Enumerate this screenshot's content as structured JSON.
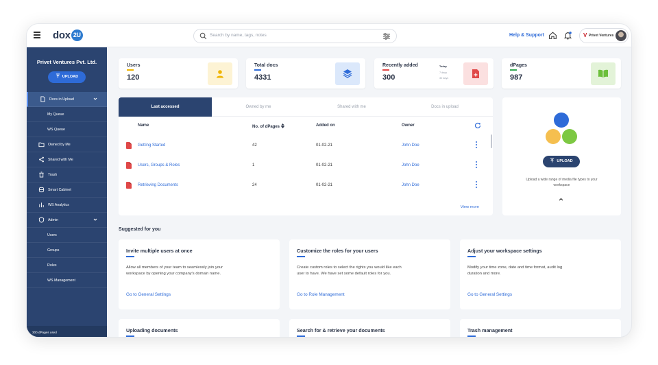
{
  "header": {
    "logo_text": "dox",
    "logo_badge": "2U",
    "search_placeholder": "Search by name, tags, notes",
    "help_label": "Help & Support",
    "org_short": "Privet Ventures",
    "org_logo_letter": "V"
  },
  "sidebar": {
    "org_name": "Privet Ventures Pvt. Ltd.",
    "upload_label": "UPLOAD",
    "items": [
      {
        "label": "Docs in Upload"
      },
      {
        "label": "My Queue"
      },
      {
        "label": "WS Queue"
      },
      {
        "label": "Owned by Me"
      },
      {
        "label": "Shared with Me"
      },
      {
        "label": "Trash"
      },
      {
        "label": "Smart Cabinet"
      },
      {
        "label": "WS Analytics"
      },
      {
        "label": "Admin"
      },
      {
        "label": "Users"
      },
      {
        "label": "Groups"
      },
      {
        "label": "Roles"
      },
      {
        "label": "WS Management"
      }
    ],
    "used_text": "300 dPages used"
  },
  "stats": [
    {
      "label": "Users",
      "value": "120",
      "accent": "#f0b400"
    },
    {
      "label": "Total docs",
      "value": "4331",
      "accent": "#2e6bd8"
    },
    {
      "label": "Recently added",
      "value": "300",
      "accent": "#e04848",
      "periods": [
        "Today",
        "7 days",
        "30 days"
      ]
    },
    {
      "label": "dPages",
      "value": "987",
      "accent": "#34a853"
    }
  ],
  "table": {
    "tabs": [
      "Last accessed",
      "Owned by me",
      "Shared with me",
      "Docs in upload"
    ],
    "columns": [
      "Name",
      "No. of dPages",
      "Added on",
      "Owner"
    ],
    "rows": [
      {
        "name": "Getting Started",
        "pages": "42",
        "added": "01-02-21",
        "owner": "John Doe"
      },
      {
        "name": "Users, Groups & Roles",
        "pages": "1",
        "added": "01-02-21",
        "owner": "John Doe"
      },
      {
        "name": "Retrieving Documents",
        "pages": "24",
        "added": "01-02-21",
        "owner": "John Doe"
      }
    ],
    "view_more": "View more"
  },
  "upload_panel": {
    "button": "UPLOAD",
    "text": "Upload a wide range of media file types to your workspace"
  },
  "suggested": {
    "title": "Suggested for you",
    "cards": [
      {
        "title": "Invite multiple users at once",
        "desc": "Allow all members of your team to seamlessly join your workspace by opening your company's domain name.",
        "link": "Go to General Settings"
      },
      {
        "title": "Customize the roles for your users",
        "desc": "Create custom roles to select the rights you would like each user to have. We have set some default roles for you.",
        "link": "Go to Role Management"
      },
      {
        "title": "Adjust your workspace settings",
        "desc": "Modify your time zone, date and time format, audit log duration and more.",
        "link": "Go to General Settings"
      },
      {
        "title": "Uploading documents"
      },
      {
        "title": "Search for & retrieve your documents"
      },
      {
        "title": "Trash management"
      }
    ]
  }
}
